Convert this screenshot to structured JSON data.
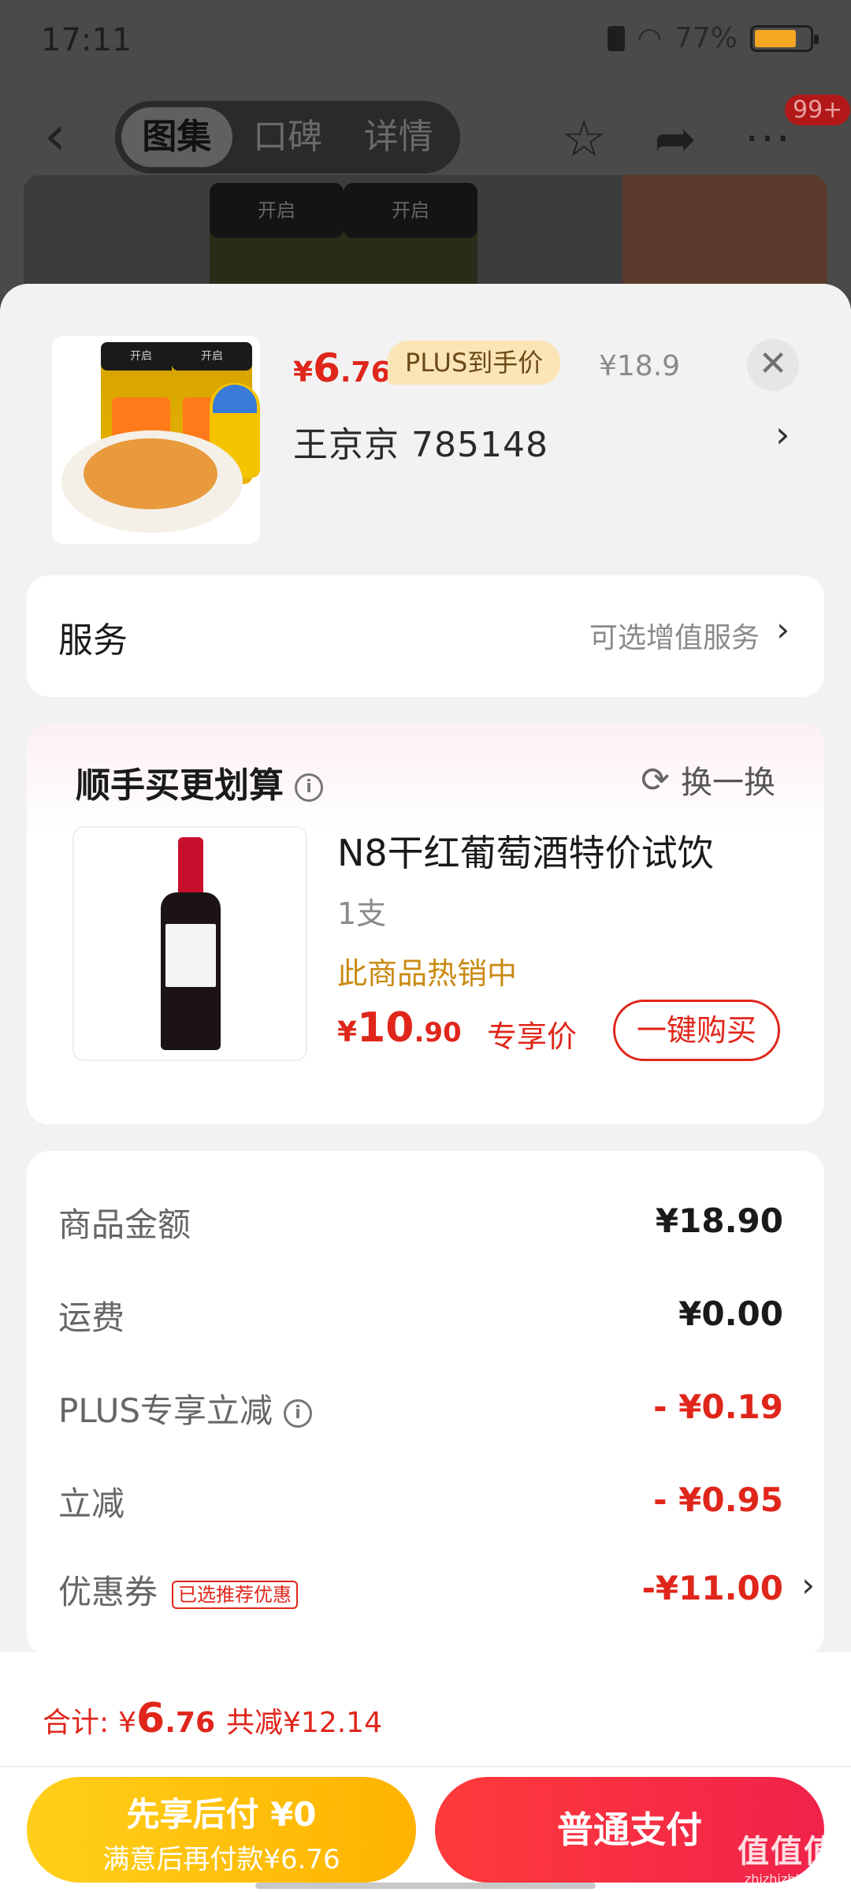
{
  "status_bar": {
    "time": "17:11",
    "battery": "77%",
    "battery_level": 0.77
  },
  "nav": {
    "tabs": [
      {
        "label": "图集",
        "active": true
      },
      {
        "label": "口碑",
        "active": false
      },
      {
        "label": "详情",
        "active": false
      }
    ],
    "badge": "99+"
  },
  "background": {
    "jar_lid_text": "开启"
  },
  "product": {
    "price_symbol": "¥",
    "price_int": "6",
    "price_dec": ".76",
    "plus_tag": "PLUS到手价",
    "original_price": "¥18.9",
    "spec": "王京京  785148"
  },
  "service": {
    "title": "服务",
    "hint": "可选增值服务"
  },
  "bundle": {
    "title": "顺手买更划算",
    "swap_label": "换一换",
    "item": {
      "name": "N8干红葡萄酒特价试饮",
      "qty": "1支",
      "status": "此商品热销中",
      "price_symbol": "¥",
      "price_int": "10",
      "price_dec": ".90",
      "price_label": "专享价",
      "buy_label": "一键购买"
    }
  },
  "summary": {
    "rows": [
      {
        "label": "商品金额",
        "value": "¥18.90"
      },
      {
        "label": "运费",
        "value": "¥0.00"
      },
      {
        "label": "PLUS专享立减",
        "value": "- ¥0.19"
      },
      {
        "label": "立减",
        "value": "- ¥0.95"
      },
      {
        "label": "优惠券",
        "value": "-¥11.00",
        "tag": "已选推荐优惠"
      }
    ]
  },
  "footer": {
    "total_label": "合计:",
    "total_symbol": "¥",
    "total_int": "6",
    "total_dec": ".76",
    "total_saved": "共减¥12.14",
    "pay_later_line1": "先享后付 ¥0",
    "pay_later_line2": "满意后再付款¥6.76",
    "pay_normal_label": "普通支付"
  },
  "watermark": {
    "line1": "值值值",
    "line2": "zhizhizhi.com"
  },
  "colors": {
    "accent_red": "#e0261b",
    "gold": "#ffb300",
    "plus_tag_bg": "#fbe5b7"
  }
}
